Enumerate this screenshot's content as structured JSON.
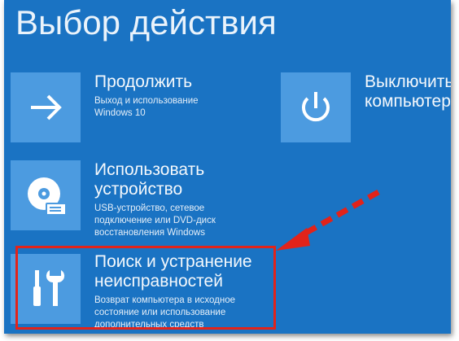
{
  "screen": {
    "title": "Выбор действия",
    "background_color": "#1a73c3",
    "tile_color": "#4c9be0"
  },
  "options": {
    "continue": {
      "icon": "arrow-right-icon",
      "title": "Продолжить",
      "description": "Выход и использование Windows 10"
    },
    "use_device": {
      "icon": "disc-drive-icon",
      "title_line1": "Использовать",
      "title_line2": "устройство",
      "description_line1": "USB-устройство, сетевое",
      "description_line2": "подключение или DVD-диск",
      "description_line3": "восстановления Windows"
    },
    "troubleshoot": {
      "icon": "tools-icon",
      "title_line1": "Поиск и устранение",
      "title_line2": "неисправностей",
      "description_line1": "Возврат компьютера в исходное",
      "description_line2": "состояние или использование",
      "description_line3": "дополнительных средств"
    },
    "shutdown": {
      "icon": "power-icon",
      "title_line1": "Выключить",
      "title_line2": "компьютер"
    }
  },
  "annotation": {
    "highlight_color": "#e2231a",
    "pointer": "dashed-arrow"
  }
}
